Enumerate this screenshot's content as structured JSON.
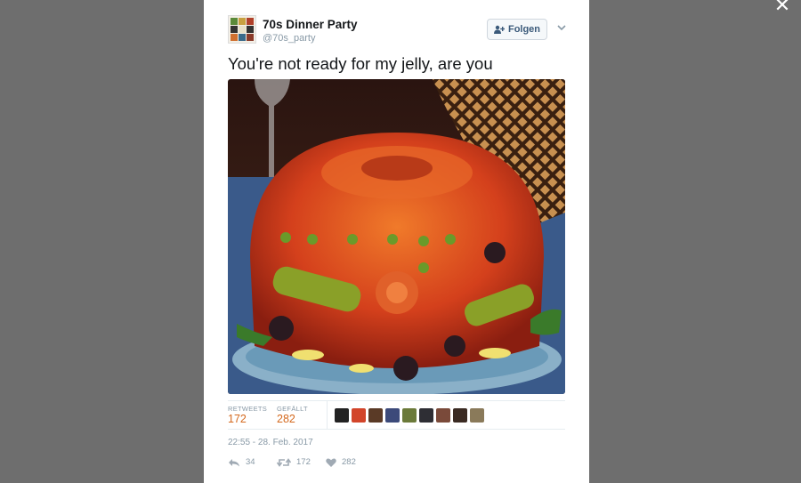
{
  "overlay": {
    "close_glyph": "✕"
  },
  "tweet": {
    "author_name": "70s Dinner Party",
    "author_handle": "@70s_party",
    "follow_label": "Folgen",
    "text": "You're not ready for my jelly, are you",
    "stats": {
      "retweets_label": "RETWEETS",
      "retweets_value": "172",
      "likes_label": "GEFÄLLT",
      "likes_value": "282"
    },
    "timestamp": "22:55 - 28. Feb. 2017",
    "actions": {
      "reply_count": "34",
      "retweet_count": "172",
      "like_count": "282"
    }
  },
  "colors": {
    "accent_orange": "#d4691e",
    "muted_text": "#8899a6",
    "follow_text": "#3b5a7a"
  },
  "liker_faces": [
    {
      "name": "liker-1",
      "color": "#222222"
    },
    {
      "name": "liker-2",
      "color": "#d2452a"
    },
    {
      "name": "liker-3",
      "color": "#5a3a26"
    },
    {
      "name": "liker-4",
      "color": "#3c4a7a"
    },
    {
      "name": "liker-5",
      "color": "#6b7a3a"
    },
    {
      "name": "liker-6",
      "color": "#2e2e34"
    },
    {
      "name": "liker-7",
      "color": "#7a4a3a"
    },
    {
      "name": "liker-8",
      "color": "#3a2a22"
    },
    {
      "name": "liker-9",
      "color": "#8a7a5a"
    }
  ]
}
